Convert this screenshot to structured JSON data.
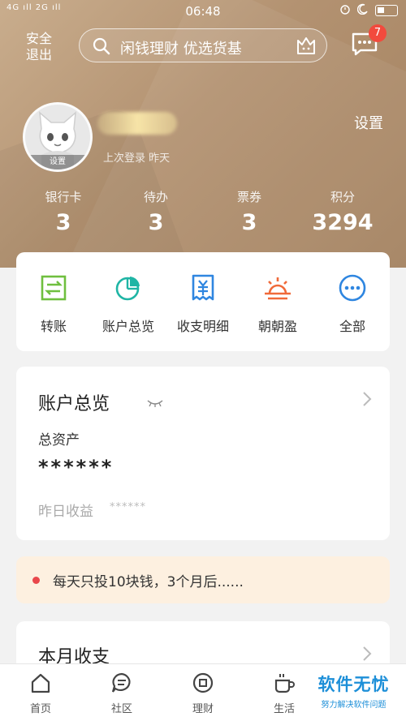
{
  "status_bar": {
    "signal": "4G ıll 2G ıll",
    "time": "06:48"
  },
  "header": {
    "logout_label": "安全\n退出",
    "search_text": "闲钱理财 优选货基",
    "message_badge": "7"
  },
  "profile": {
    "avatar_label": "设置",
    "last_login": "上次登录 昨天",
    "settings_label": "设置"
  },
  "stats": [
    {
      "label": "银行卡",
      "value": "3"
    },
    {
      "label": "待办",
      "value": "3"
    },
    {
      "label": "票券",
      "value": "3"
    },
    {
      "label": "积分",
      "value": "3294"
    }
  ],
  "quick_actions": [
    {
      "label": "转账",
      "icon": "transfer-icon",
      "color": "#6fbf3f"
    },
    {
      "label": "账户总览",
      "icon": "pie-chart-icon",
      "color": "#1fb5a5"
    },
    {
      "label": "收支明细",
      "icon": "receipt-icon",
      "color": "#2f86e0"
    },
    {
      "label": "朝朝盈",
      "icon": "sunrise-icon",
      "color": "#f06a3a"
    },
    {
      "label": "全部",
      "icon": "more-icon",
      "color": "#2f86e0"
    }
  ],
  "account_card": {
    "title": "账户总览",
    "total_assets_label": "总资产",
    "total_assets_value": "******",
    "yesterday_label": "昨日收益",
    "yesterday_value": "******"
  },
  "notice": {
    "text": "每天只投10块钱，3个月后......"
  },
  "monthly_card": {
    "title": "本月收支"
  },
  "tabbar": [
    {
      "label": "首页",
      "icon": "home-icon"
    },
    {
      "label": "社区",
      "icon": "community-icon"
    },
    {
      "label": "理财",
      "icon": "finance-icon"
    },
    {
      "label": "生活",
      "icon": "coffee-icon"
    }
  ],
  "watermark": {
    "title": "软件无忧",
    "subtitle": "努力解决软件问题"
  }
}
